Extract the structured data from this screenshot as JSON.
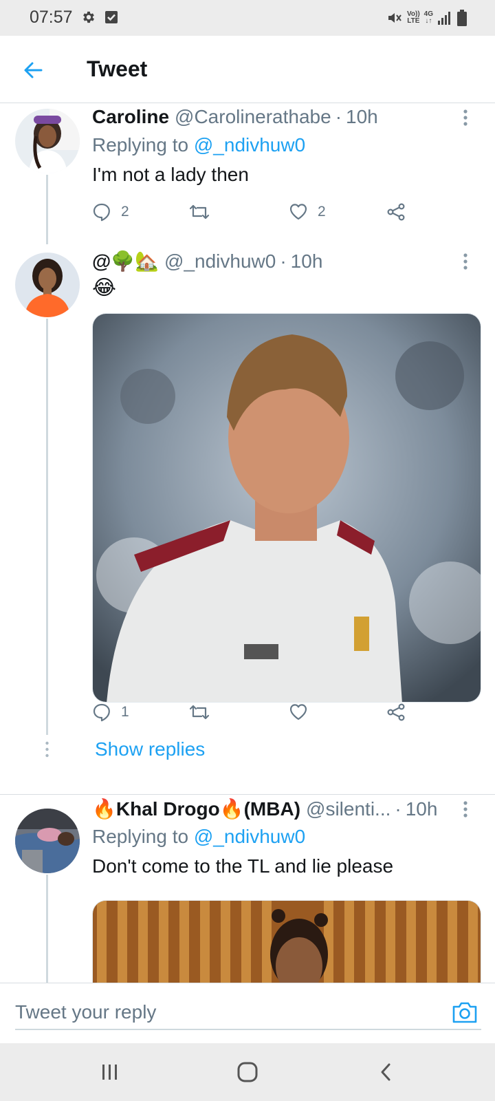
{
  "status_bar": {
    "time": "07:57",
    "network_label_top": "Vo))",
    "network_label_bottom": "LTE",
    "data_label": "4G",
    "icons": [
      "gear-icon",
      "checkbox-icon",
      "mute-icon",
      "signal-icon",
      "battery-icon"
    ]
  },
  "header": {
    "title": "Tweet",
    "back_icon": "arrow-left-icon"
  },
  "tweets": [
    {
      "name": "Caroline",
      "handle": "@Carolinerathabe",
      "separator": "·",
      "time": "10h",
      "reply_prefix": "Replying to",
      "reply_to": "@_ndivhuw0",
      "text": "I'm not a lady then",
      "replies": "2",
      "retweets": "",
      "likes": "2"
    },
    {
      "name": "@🌳🏡",
      "handle": "@_ndivhuw0",
      "separator": "·",
      "time": "10h",
      "text": "😂",
      "replies": "1",
      "retweets": "",
      "likes": "",
      "show_replies": "Show replies"
    },
    {
      "name": "🔥Khal Drogo🔥(MBA)",
      "handle": "@silenti...",
      "separator": "·",
      "time": "10h",
      "reply_prefix": "Replying to",
      "reply_to": "@_ndivhuw0",
      "text": "Don't come to the TL and lie please"
    }
  ],
  "reply_bar": {
    "placeholder": "Tweet your reply",
    "camera_icon": "camera-icon"
  },
  "colors": {
    "accent": "#1da1f2",
    "secondary_text": "#657786",
    "primary_text": "#14171a"
  }
}
